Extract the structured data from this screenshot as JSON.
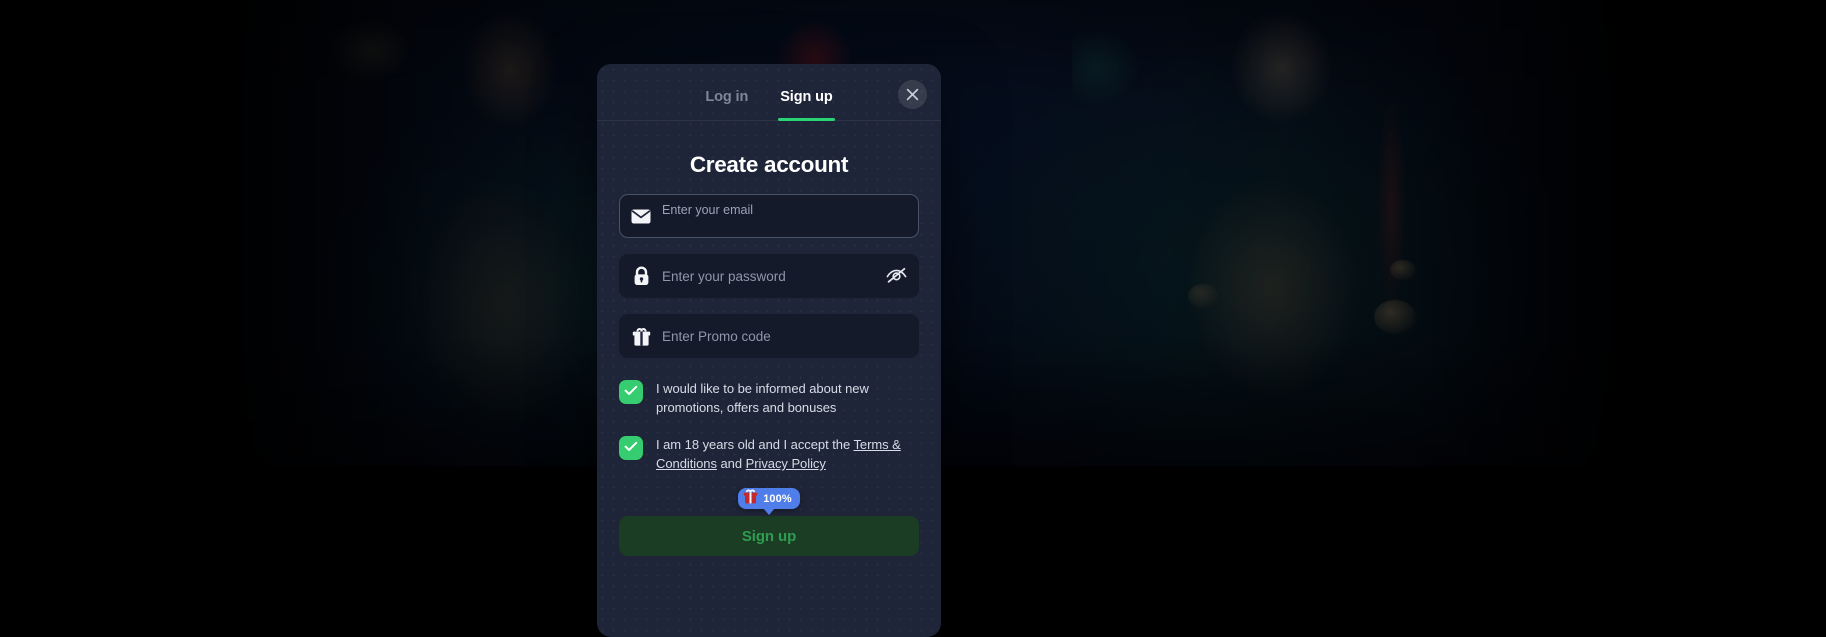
{
  "background": {
    "scene_description": "darkened casino game artwork backdrop",
    "art_left_name": "adventurer-character-art",
    "art_right_name": "egyptian-horus-character-art"
  },
  "modal": {
    "tabs": [
      {
        "label": "Log in",
        "active": false
      },
      {
        "label": "Sign up",
        "active": true
      }
    ],
    "close_icon": "close-icon",
    "title": "Create account",
    "fields": [
      {
        "name": "email",
        "icon": "envelope-icon",
        "placeholder": "Enter your email",
        "value": "",
        "focused": true
      },
      {
        "name": "password",
        "icon": "lock-icon",
        "placeholder": "Enter your password",
        "value": "",
        "focused": false,
        "trailing_icon": "eye-off-icon"
      },
      {
        "name": "promo",
        "icon": "gift-icon",
        "placeholder": "Enter Promo code",
        "value": "",
        "focused": false
      }
    ],
    "checkboxes": [
      {
        "name": "promotions",
        "checked": true,
        "label": "I would like to be informed about new promotions, offers and bonuses"
      },
      {
        "name": "terms",
        "checked": true,
        "label_part1": "I am 18 years old and I accept the ",
        "link1": "Terms & Conditions",
        "label_part2": " and ",
        "link2": "Privacy Policy"
      }
    ],
    "bonus_badge": {
      "icon": "gift-box-icon",
      "text": "100%"
    },
    "submit": {
      "label": "Sign up",
      "enabled": false
    }
  },
  "colors": {
    "accent_green": "#28d474",
    "checkbox_green": "#35cd6f",
    "badge_blue": "#4f7dea",
    "panel_bg": "#1f2538",
    "field_bg": "#151a2a",
    "submit_bg": "#1b3d23",
    "submit_text": "#2f9c52"
  }
}
